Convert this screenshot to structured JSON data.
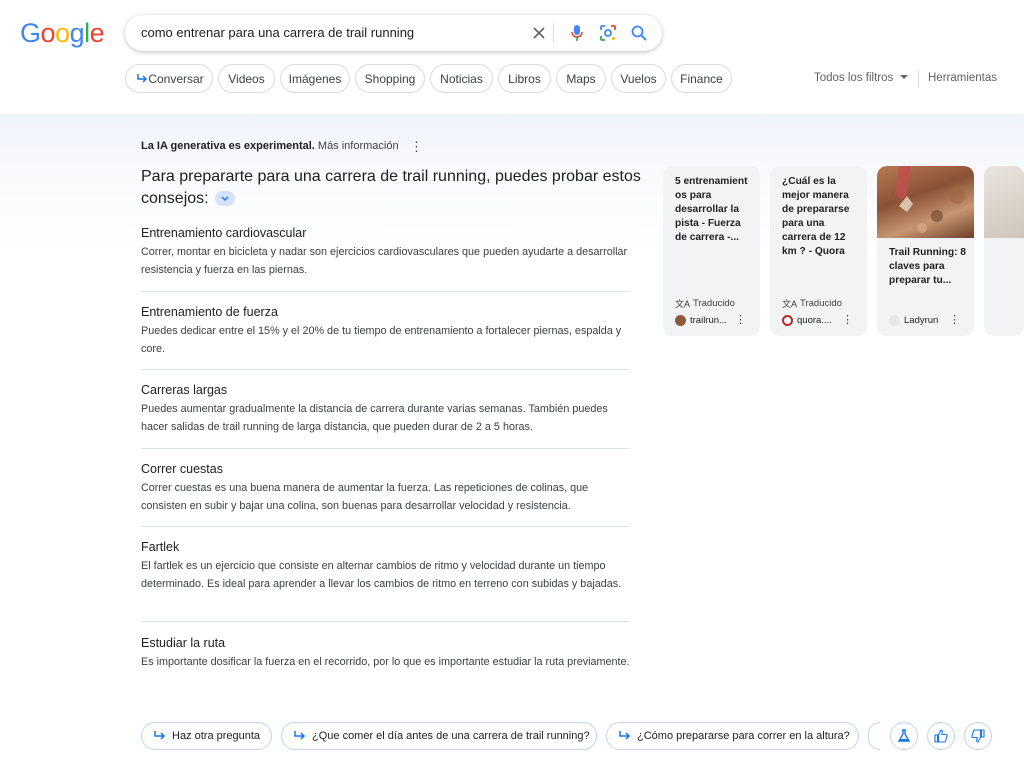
{
  "logo": {
    "letters": [
      "G",
      "o",
      "o",
      "g",
      "l",
      "e"
    ],
    "colors": [
      "#4285F4",
      "#EA4335",
      "#FBBC05",
      "#4285F4",
      "#34A853",
      "#EA4335"
    ]
  },
  "search": {
    "query": "como entrenar para una carrera de trail running"
  },
  "chips": [
    "Conversar",
    "Videos",
    "Imágenes",
    "Shopping",
    "Noticias",
    "Libros",
    "Maps",
    "Vuelos",
    "Finance"
  ],
  "filters": {
    "all": "Todos los filtros",
    "tools": "Herramientas"
  },
  "ai": {
    "disclaimer_bold": "La IA generativa es experimental.",
    "disclaimer_link": "Más información",
    "headline": "Para prepararte para una carrera de trail running, puedes probar estos consejos:",
    "tips": [
      {
        "title": "Entrenamiento cardiovascular",
        "text": "Correr, montar en bicicleta y nadar son ejercicios cardiovasculares que pueden ayudarte a desarrollar resistencia y fuerza en las piernas."
      },
      {
        "title": "Entrenamiento de fuerza",
        "text": "Puedes dedicar entre el 15% y el 20% de tu tiempo de entrenamiento a fortalecer piernas, espalda y core."
      },
      {
        "title": "Carreras largas",
        "text": "Puedes aumentar gradualmente la distancia de carrera durante varias semanas. También puedes hacer salidas de trail running de larga distancia, que pueden durar de 2 a 5 horas."
      },
      {
        "title": "Correr cuestas",
        "text": "Correr cuestas es una buena manera de aumentar la fuerza. Las repeticiones de colinas, que consisten en subir y bajar una colina, son buenas para desarrollar velocidad y resistencia."
      },
      {
        "title": "Fartlek",
        "text": "El fartlek es un ejercicio que consiste en alternar cambios de ritmo y velocidad durante un tiempo determinado. Es ideal para aprender a llevar los cambios de ritmo en terreno con subidas y bajadas."
      },
      {
        "title": "Estudiar la ruta",
        "text": "Es importante dosificar la fuerza en el recorrido, por lo que es importante estudiar la ruta previamente."
      }
    ]
  },
  "cards": [
    {
      "title": "5 entrenamient os para desarrollar la pista - Fuerza de carrera -...",
      "translated": "Traducido",
      "source": "trailrun...",
      "fav_color": "#8d5a3a"
    },
    {
      "title": "¿Cuál es la mejor manera de prepararse para una carrera de 12 km ? - Quora",
      "translated": "Traducido",
      "source": "quora....",
      "fav_color": "#b92b27"
    },
    {
      "title": "Trail Running: 8 claves para preparar tu...",
      "source": "Ladyrun",
      "fav_color": "#cfcfcf"
    }
  ],
  "followups": {
    "ask": "Haz otra pregunta",
    "q1": "¿Que comer el día antes de una carrera de trail running?",
    "q2": "¿Cómo prepararse para correr en la altura?"
  }
}
